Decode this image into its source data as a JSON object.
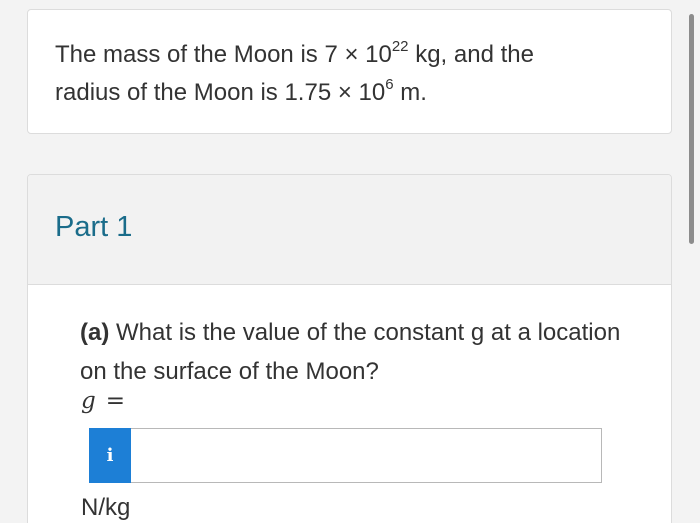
{
  "problem": {
    "line1_prefix": "The mass of the Moon is 7 × 10",
    "mass_exponent": "22",
    "line1_suffix": " kg, and the",
    "line2_prefix": "radius of the Moon is 1.75 × 10",
    "radius_exponent": "6",
    "line2_suffix": " m."
  },
  "part": {
    "title": "Part 1",
    "question_label": "(a)",
    "question_text": " What is the value of the constant g at a location on the surface of the Moon?",
    "variable": "g",
    "equals": "=",
    "info_icon_glyph": "i",
    "input_value": "",
    "input_placeholder": "",
    "unit": "N/kg"
  },
  "colors": {
    "accent_blue": "#1d7fd6",
    "part_title": "#1a6c8a",
    "background": "#f3f3f3"
  }
}
